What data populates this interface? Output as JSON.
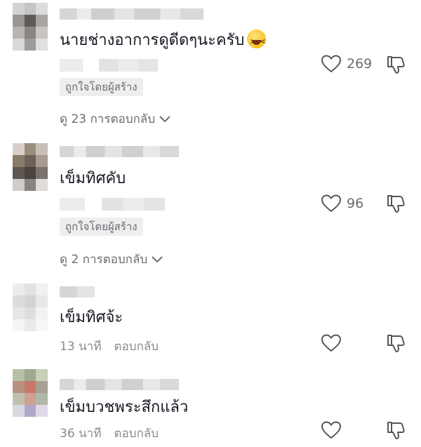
{
  "colors": {
    "text": "#161823",
    "secondary": "#8a8b91",
    "badge_bg": "#eeeeef",
    "icon": "#55565c"
  },
  "comments": [
    {
      "text": "นายช่างอาการดูดีดๆนะครับ",
      "emoji": "grinning-squinting-face",
      "creator_liked_label": "ถูกใจโดยผู้สร้าง",
      "view_replies_label": "ดู 23 การตอบกลับ",
      "like_count": "269"
    },
    {
      "text": "เข็มทิศคับ",
      "creator_liked_label": "ถูกใจโดยผู้สร้าง",
      "view_replies_label": "ดู 2 การตอบกลับ",
      "like_count": "96"
    },
    {
      "text": "เข็มทิศจ้ะ",
      "time": "13 นาที",
      "reply_label": "ตอบกลับ",
      "like_count": ""
    },
    {
      "text": "เข็มบวชพระสึกแล้ว",
      "time": "36 นาที",
      "reply_label": "ตอบกลับ",
      "like_count": ""
    }
  ]
}
